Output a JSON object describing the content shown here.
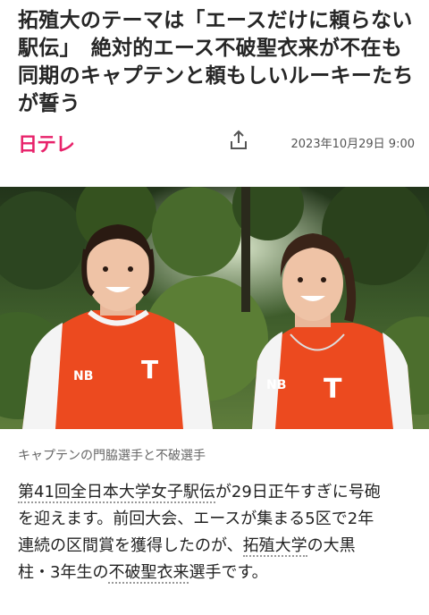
{
  "headline": {
    "line1": "拓殖大のテーマは「エースだけに頼らない",
    "line2": "駅伝」　絶対的エース不破聖衣来が不在も",
    "line3": "同期のキャプテンと頼もしいルーキーたち",
    "line4": "が誓う"
  },
  "meta": {
    "logo_text": "日テレ",
    "share_icon": "share-icon",
    "date": "2023年10月29日 9:00"
  },
  "photo": {
    "jersey_letter_left": "T",
    "jersey_letter_right": "T",
    "brand_mark": "NB"
  },
  "caption": "キャプテンの門脇選手と不破選手",
  "body": {
    "l1_link1": "第41回全日本大学女子駅伝",
    "l1_rest": "が29日正午すぎに号砲",
    "l2": "を迎えます。前回大会、エースが集まる5区で2年",
    "l3_pre": "連続の区間賞を獲得したのが、",
    "l3_link": "拓殖大学",
    "l3_post": "の大黒",
    "l4_pre": "柱・3年生の",
    "l4_link": "不破聖衣来",
    "l4_post": "選手です。"
  },
  "colors": {
    "brand": "#e8226a",
    "jersey": "#ec4a1f"
  }
}
